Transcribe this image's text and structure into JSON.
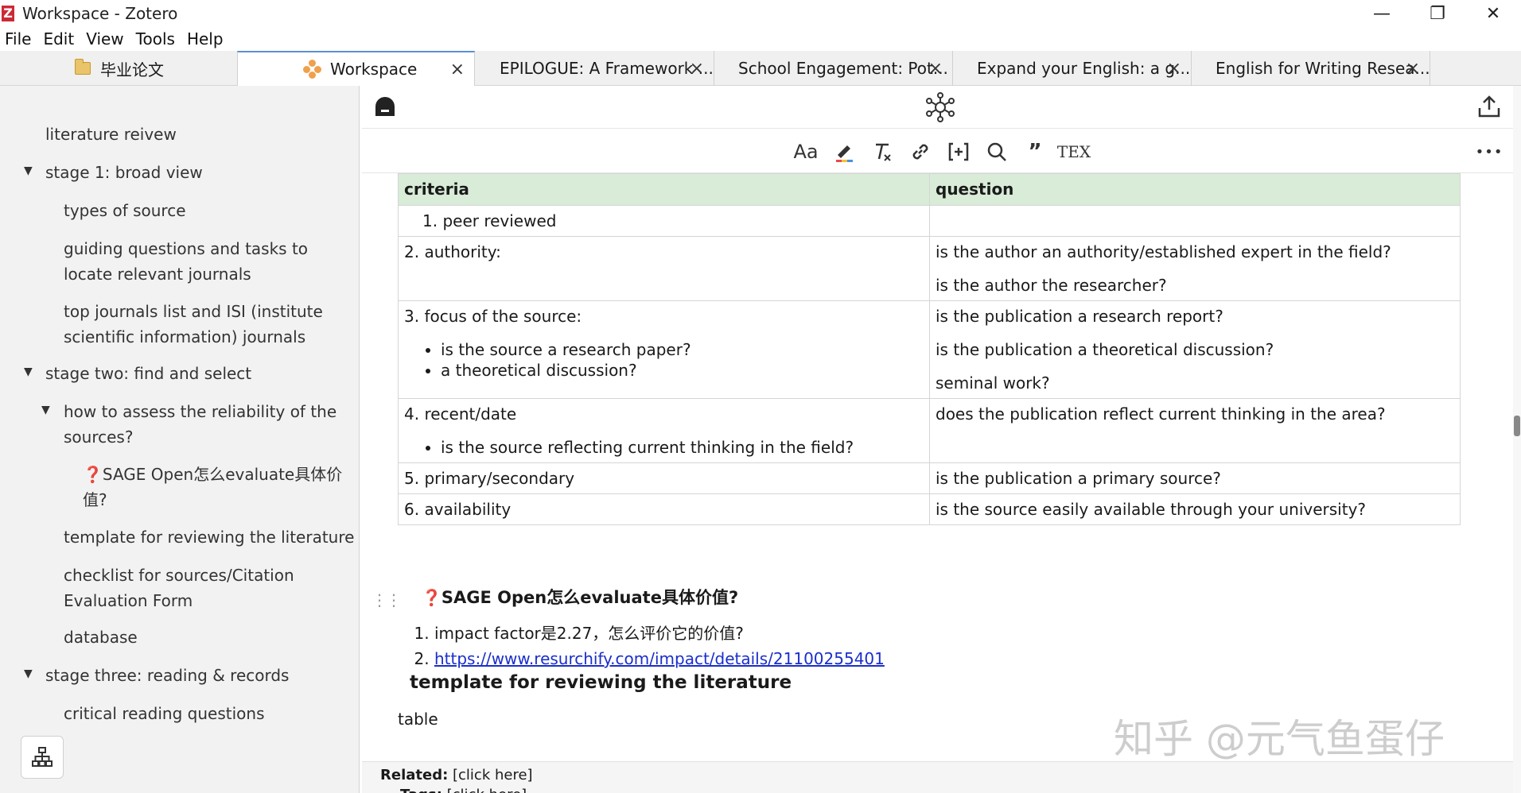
{
  "window": {
    "title": "Workspace - Zotero",
    "logo_letter": "Z",
    "controls": {
      "minimize": "—",
      "restore": "❐",
      "close": "✕"
    }
  },
  "menu": [
    "File",
    "Edit",
    "View",
    "Tools",
    "Help"
  ],
  "tabs": {
    "library": "毕业论文",
    "items": [
      {
        "label": "Workspace",
        "active": true
      },
      {
        "label": "EPILOGUE: A Framework ..."
      },
      {
        "label": "School Engagement: Pot..."
      },
      {
        "label": "Expand your English: a g..."
      },
      {
        "label": "English for Writing Resea..."
      }
    ],
    "close_glyph": "×"
  },
  "outline": [
    {
      "label": "literature reivew"
    },
    {
      "label": "stage 1:   broad view",
      "twisty": "▼"
    },
    {
      "label": "types of source"
    },
    {
      "label": "guiding questions and tasks to"
    },
    {
      "label": "locate relevant journals"
    },
    {
      "label": "top journals list and ISI (institute"
    },
    {
      "label": "scientific information) journals"
    },
    {
      "label": "stage two: find and select",
      "twisty": "▼"
    },
    {
      "label": "how to assess the reliability of the",
      "twisty": "▼"
    },
    {
      "label": "sources?"
    },
    {
      "label": "❓SAGE Open怎么evaluate具体价"
    },
    {
      "label": "值?"
    },
    {
      "label": "template for reviewing the literature"
    },
    {
      "label": "checklist for sources/Citation"
    },
    {
      "label": "Evaluation Form"
    },
    {
      "label": "database"
    },
    {
      "label": "stage three: reading & records",
      "twisty": "▼"
    },
    {
      "label": "critical reading questions"
    }
  ],
  "toolbar_icons": [
    "font-size-icon",
    "highlight-icon",
    "clear-format-icon",
    "link-icon",
    "citation-icon",
    "find-icon",
    "quote-icon",
    "tex-icon"
  ],
  "toolbar": {
    "font": "Aa",
    "quote": "”",
    "tex": "TEX",
    "more": "•••"
  },
  "table": {
    "headers": [
      "criteria",
      "question"
    ],
    "rows": [
      {
        "c1": "1. peer reviewed",
        "c2": ""
      },
      {
        "c1": "2. authority:",
        "c2a": "is the author an authority/established expert in the field?",
        "c2b": "is the author the researcher?"
      },
      {
        "c1": "3. focus of the source:",
        "b1": "is the source a research paper?",
        "b2": "a theoretical discussion?",
        "c2a": "is the publication a research report?",
        "c2b": "is the publication a theoretical discussion?",
        "c2c": "seminal work?"
      },
      {
        "c1": "4. recent/date",
        "b1": "is the source reflecting current thinking in the field?",
        "c2": "does the publication reflect current thinking in the area?"
      },
      {
        "c1": "5. primary/secondary",
        "c2": "is the publication a primary source?"
      },
      {
        "c1": "6. availability",
        "c2": "is the source easily available through your university?"
      }
    ]
  },
  "sage": {
    "heading": "SAGE Open怎么evaluate具体价值?",
    "heading_mark": "❓",
    "items": [
      "impact factor是2.27，怎么评价它的价值?",
      "https://www.resurchify.com/impact/details/21100255401"
    ]
  },
  "template_heading": "template for reviewing the literature",
  "table_label": "table",
  "footer": {
    "related_label": "Related:",
    "related_value": "[click here]",
    "tags_label": "Tags:",
    "tags_value": "[click here]"
  },
  "watermark": "知乎 @元气鱼蛋仔"
}
